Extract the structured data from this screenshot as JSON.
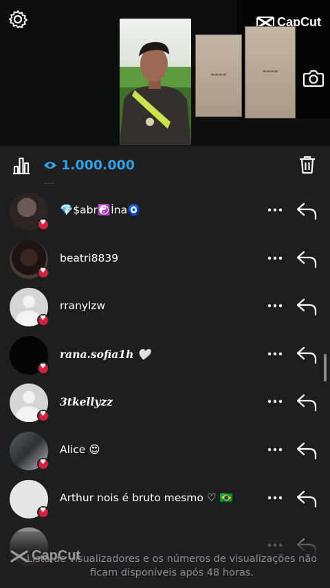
{
  "watermark_top": "CapCut",
  "watermark_bottom": "CapCut",
  "stats": {
    "views": "1.000.000"
  },
  "viewers": [
    {
      "name": "💎$abr☯️İna🧿",
      "avatar": "photo1",
      "serif": false
    },
    {
      "name": "beatri8839",
      "avatar": "photo2",
      "serif": false
    },
    {
      "name": "rranylzw",
      "avatar": "default",
      "serif": false
    },
    {
      "name": "rana.sofia1h 🤍",
      "avatar": "dark",
      "serif": true
    },
    {
      "name": "3tkellyzz",
      "avatar": "default",
      "serif": true
    },
    {
      "name": "Alice 😍",
      "avatar": "photo3",
      "serif": false
    },
    {
      "name": "Arthur  nois é bruto mesmo ♡ 🇧🇷",
      "avatar": "sign",
      "serif": false
    },
    {
      "name": "",
      "avatar": "partial",
      "serif": false
    }
  ],
  "footer_note": "Lista de visualizadores e os números de visualizações não ficam disponíveis após 48 horas.",
  "colors": {
    "accent": "#2ea1e6",
    "heart": "#d61f3c",
    "sheet": "#1d1e20"
  },
  "icons": [
    "gear-icon",
    "camera-icon",
    "bar-chart-icon",
    "eye-icon",
    "trash-icon",
    "more-icon",
    "reply-icon",
    "heart-icon"
  ]
}
